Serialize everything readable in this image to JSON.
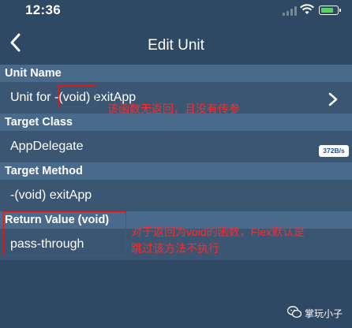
{
  "status_bar": {
    "time": "12:36"
  },
  "nav": {
    "title": "Edit Unit"
  },
  "sections": {
    "unit_name": {
      "header": "Unit Name",
      "value_prefix": "Unit for -",
      "value_highlight": "(void)",
      "value_suffix": " exitApp"
    },
    "target_class": {
      "header": "Target Class",
      "value": "AppDelegate"
    },
    "target_method": {
      "header": "Target Method",
      "value": "-(void) exitApp"
    },
    "return_value": {
      "header": "Return Value (void)",
      "value": "pass-through"
    }
  },
  "speed_badge": "372B/s",
  "annotations": {
    "note1": "该函数无返回，且没有传参",
    "note2_line1": "对于返回为void的函数，Flex默认是",
    "note2_line2": "跳过该方法不执行"
  },
  "watermark": {
    "text": "掌玩小子"
  },
  "colors": {
    "background": "#2f4863",
    "section_header": "#4a6a8b",
    "row": "#3b5673",
    "annotation": "#e21a1a"
  }
}
